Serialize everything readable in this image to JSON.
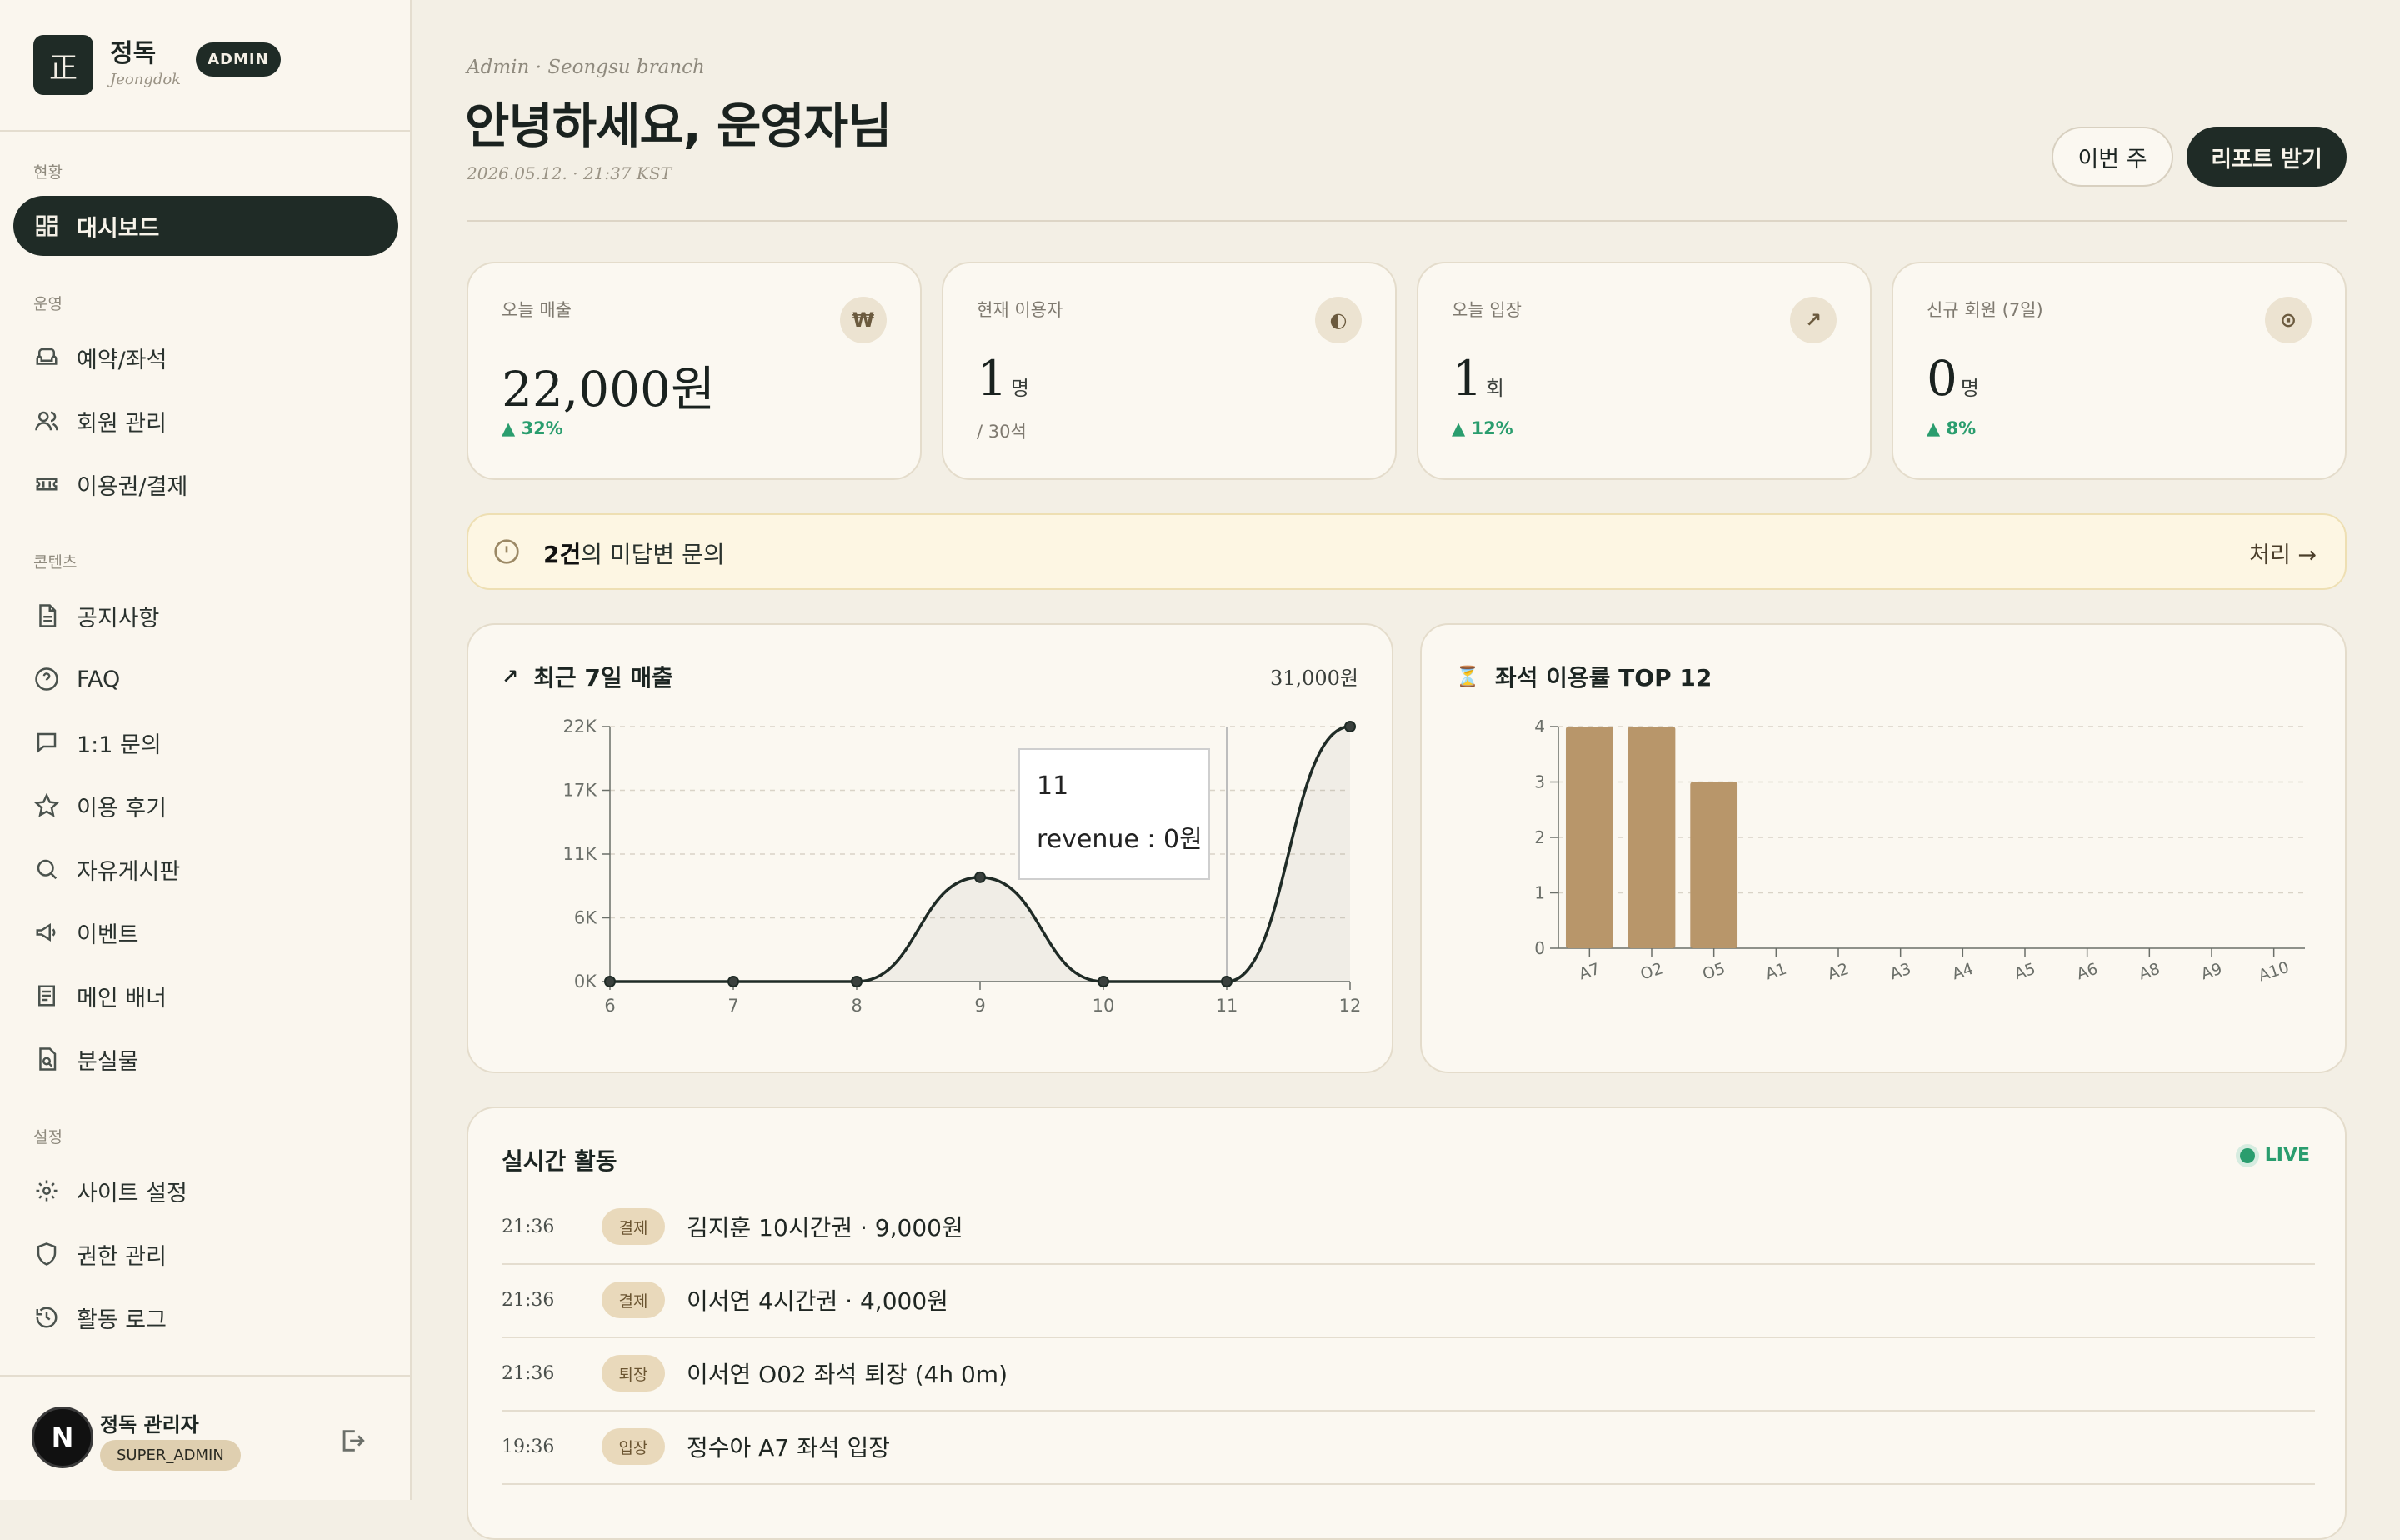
{
  "brand": {
    "logo_glyph": "正",
    "name": "정독",
    "sub": "Jeongdok",
    "badge": "ADMIN"
  },
  "nav": {
    "sections": [
      "현황",
      "운영",
      "콘텐츠",
      "설정"
    ],
    "items": [
      {
        "label": "대시보드",
        "icon": "grid-icon"
      },
      {
        "label": "예약/좌석",
        "icon": "armchair-icon"
      },
      {
        "label": "회원 관리",
        "icon": "users-icon"
      },
      {
        "label": "이용권/결제",
        "icon": "ticket-icon"
      },
      {
        "label": "공지사항",
        "icon": "document-icon"
      },
      {
        "label": "FAQ",
        "icon": "help-circle-icon"
      },
      {
        "label": "1:1 문의",
        "icon": "message-icon"
      },
      {
        "label": "이용 후기",
        "icon": "star-icon"
      },
      {
        "label": "자유게시판",
        "icon": "search-icon"
      },
      {
        "label": "이벤트",
        "icon": "megaphone-icon"
      },
      {
        "label": "메인 배너",
        "icon": "banner-icon"
      },
      {
        "label": "분실물",
        "icon": "lost-item-icon"
      },
      {
        "label": "사이트 설정",
        "icon": "gear-icon"
      },
      {
        "label": "권한 관리",
        "icon": "shield-icon"
      },
      {
        "label": "활동 로그",
        "icon": "history-icon"
      }
    ]
  },
  "user": {
    "avatar": "N",
    "name": "정독 관리자",
    "role": "SUPER_ADMIN"
  },
  "header": {
    "breadcrumb": "Admin · Seongsu branch",
    "greeting": "안녕하세요, 운영자님",
    "timestamp": "2026.05.12. · 21:37 KST",
    "week_button": "이번 주",
    "report_button": "리포트 받기"
  },
  "stats": [
    {
      "label": "오늘 매출",
      "icon": "₩",
      "value": "22,000원",
      "unit": "",
      "sub": "▲ 32%",
      "sub_type": "up"
    },
    {
      "label": "현재 이용자",
      "icon": "◐",
      "value": "1",
      "unit": "명",
      "sub": "/ 30석",
      "sub_type": "plain"
    },
    {
      "label": "오늘 입장",
      "icon": "↗",
      "value": "1",
      "unit": "회",
      "sub": "▲ 12%",
      "sub_type": "up"
    },
    {
      "label": "신규 회원 (7일)",
      "icon": "⊙",
      "value": "0",
      "unit": "명",
      "sub": "▲ 8%",
      "sub_type": "up"
    }
  ],
  "alert": {
    "count": "2건",
    "text": "의 미답변 문의",
    "action": "처리 →"
  },
  "revenue_card": {
    "title": "최근 7일 매출",
    "icon": "↗",
    "total": "31,000원"
  },
  "seat_card": {
    "title": "좌석 이용률 TOP 12",
    "icon": "⏳"
  },
  "tooltip": {
    "label": "11",
    "value": "revenue : 0원"
  },
  "chart_data": [
    {
      "type": "line",
      "title": "최근 7일 매출",
      "x": [
        6,
        7,
        8,
        9,
        10,
        11,
        12
      ],
      "series": [
        {
          "name": "revenue",
          "values": [
            0,
            0,
            0,
            9000,
            0,
            0,
            22000
          ]
        }
      ],
      "y_ticks": [
        "0K",
        "6K",
        "11K",
        "17K",
        "22K"
      ],
      "ylim": [
        0,
        22000
      ],
      "grid": true,
      "color": "#1f2b26"
    },
    {
      "type": "bar",
      "title": "좌석 이용률 TOP 12",
      "categories": [
        "A7",
        "O2",
        "O5",
        "A1",
        "A2",
        "A3",
        "A4",
        "A5",
        "A6",
        "A8",
        "A9",
        "A10"
      ],
      "values": [
        4,
        4,
        3,
        0,
        0,
        0,
        0,
        0,
        0,
        0,
        0,
        0
      ],
      "y_ticks": [
        "0",
        "1",
        "2",
        "3",
        "4"
      ],
      "ylim": [
        0,
        4
      ],
      "grid": true,
      "color": "#b8966a"
    }
  ],
  "activity": {
    "title": "실시간 활동",
    "live": "LIVE",
    "rows": [
      {
        "time": "21:36",
        "tag": "결제",
        "desc": "김지훈 10시간권 · 9,000원"
      },
      {
        "time": "21:36",
        "tag": "결제",
        "desc": "이서연 4시간권 · 4,000원"
      },
      {
        "time": "21:36",
        "tag": "퇴장",
        "desc": "이서연 O02 좌석 퇴장 (4h 0m)"
      },
      {
        "time": "19:36",
        "tag": "입장",
        "desc": "정수아 A7 좌석 입장"
      }
    ]
  }
}
